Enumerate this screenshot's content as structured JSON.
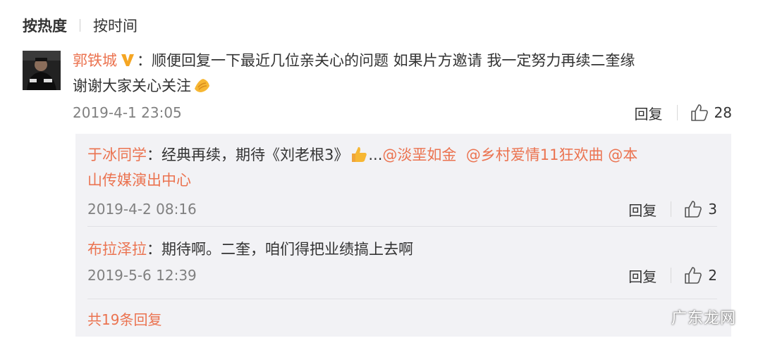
{
  "sort": {
    "hot": "按热度",
    "time": "按时间"
  },
  "comment": {
    "user": "郭铁城",
    "sep": "：",
    "text_line1": "顺便回复一下最近几位亲关心的问题 如果片方邀请 我一定努力再续二奎缘",
    "text_line2": "谢谢大家关心关注",
    "emoji": "fist-salute-emoji",
    "time": "2019-4-1 23:05",
    "reply_label": "回复",
    "likes": "28"
  },
  "replies": [
    {
      "user": "于冰同学",
      "sep": "：",
      "text": "经典再续，期待《刘老根3》",
      "after_emoji": "...",
      "mentions": [
        "@淡垩如金",
        "@乡村爱情11狂欢曲",
        "@本"
      ],
      "mention_wrap": "山传媒演出中心",
      "time": "2019-4-2 08:16",
      "reply_label": "回复",
      "likes": "3"
    },
    {
      "user": "布拉泽拉",
      "sep": "：",
      "text": "期待啊。二奎，咱们得把业绩搞上去啊",
      "time": "2019-5-6 12:39",
      "reply_label": "回复",
      "likes": "2"
    }
  ],
  "total_replies": "共19条回复",
  "watermark": "广东龙网",
  "colors": {
    "accent": "#eb7350",
    "text": "#333333",
    "muted": "#808080",
    "sub_bg": "#f2f2f5"
  },
  "icons": {
    "like": "thumbs-up-icon",
    "verified": "verified-v-icon"
  }
}
